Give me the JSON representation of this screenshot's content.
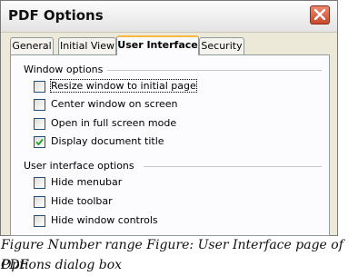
{
  "window": {
    "title": "PDF Options"
  },
  "tabs": [
    {
      "label": "General",
      "active": false
    },
    {
      "label": "Initial View",
      "active": false
    },
    {
      "label": "User Interface",
      "active": true
    },
    {
      "label": "Security",
      "active": false
    }
  ],
  "groups": {
    "window_options": {
      "label": "Window options",
      "items": [
        {
          "label": "Resize window to initial page",
          "checked": false
        },
        {
          "label": "Center window on screen",
          "checked": false
        },
        {
          "label": "Open in full screen mode",
          "checked": false
        },
        {
          "label": "Display document title",
          "checked": true
        }
      ]
    },
    "ui_options": {
      "label": "User interface options",
      "items": [
        {
          "label": "Hide menubar",
          "checked": false
        },
        {
          "label": "Hide toolbar",
          "checked": false
        },
        {
          "label": "Hide window controls",
          "checked": false
        }
      ]
    }
  },
  "caption": {
    "line1": "Figure Number range Figure: User Interface page of PDF",
    "line2": "Options dialog box"
  }
}
